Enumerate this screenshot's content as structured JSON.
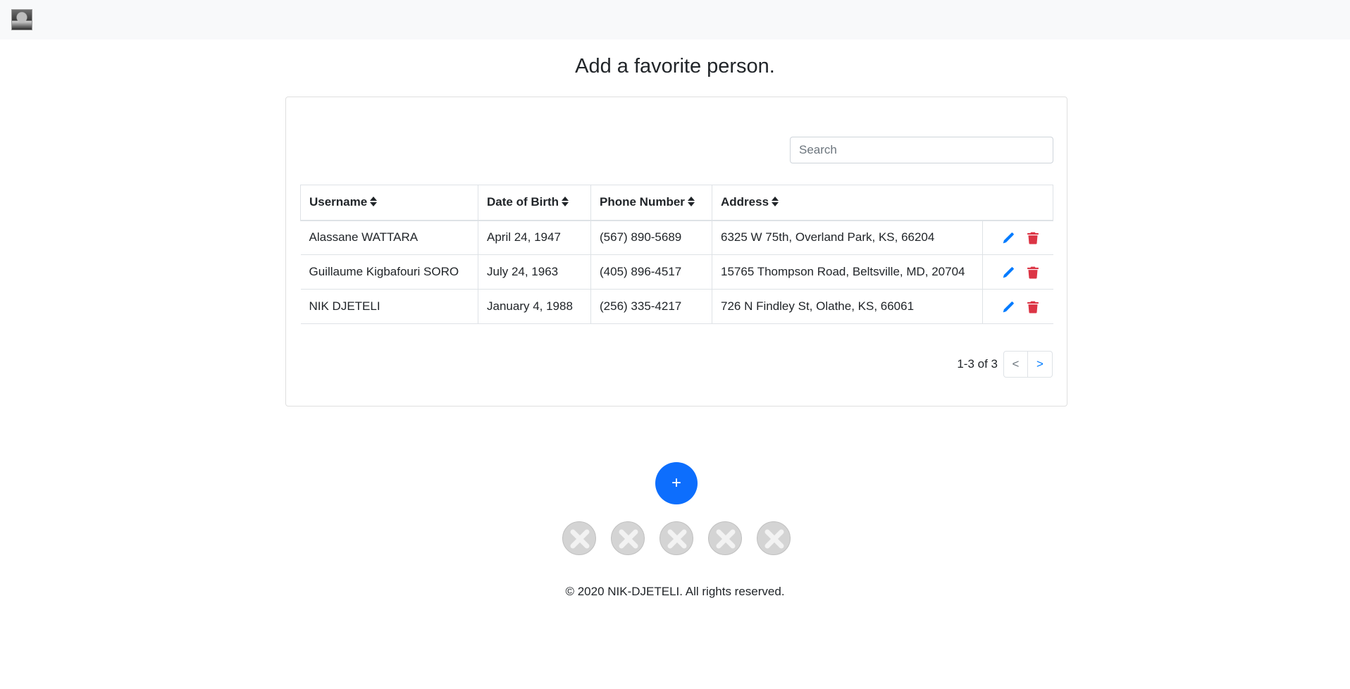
{
  "header": {
    "avatar_alt": "profile photo"
  },
  "page": {
    "title": "Add a favorite person."
  },
  "search": {
    "placeholder": "Search",
    "value": ""
  },
  "table": {
    "columns": [
      "Username",
      "Date of Birth",
      "Phone Number",
      "Address"
    ],
    "rows": [
      {
        "username": "Alassane WATTARA",
        "dob": "April 24, 1947",
        "phone": "(567) 890-5689",
        "address": "6325 W 75th, Overland Park, KS, 66204"
      },
      {
        "username": "Guillaume Kigbafouri SORO",
        "dob": "July 24, 1963",
        "phone": "(405) 896-4517",
        "address": "15765 Thompson Road, Beltsville, MD, 20704"
      },
      {
        "username": "NIK DJETELI",
        "dob": "January 4, 1988",
        "phone": "(256) 335-4217",
        "address": "726 N Findley St, Olathe, KS, 66061"
      }
    ]
  },
  "pagination": {
    "range_text": "1-3 of 3",
    "prev_label": "<",
    "next_label": ">"
  },
  "fab": {
    "label": "+"
  },
  "slots": [
    {
      "icon": "x-icon"
    },
    {
      "icon": "x-icon"
    },
    {
      "icon": "x-icon"
    },
    {
      "icon": "x-icon"
    },
    {
      "icon": "x-icon"
    }
  ],
  "footer": {
    "text": "© 2020 NIK-DJETELI. All rights reserved."
  },
  "colors": {
    "primary": "#0d6efd",
    "danger": "#dc3545",
    "edit": "#007bff"
  }
}
